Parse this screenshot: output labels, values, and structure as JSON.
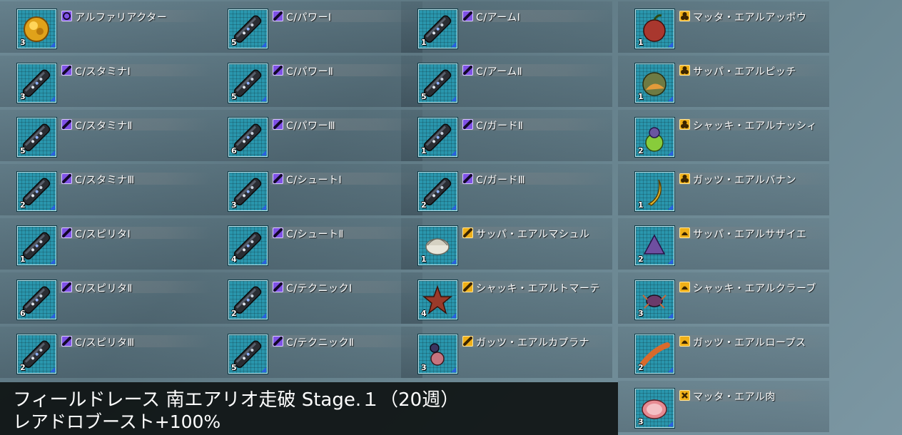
{
  "columns": [
    {
      "items": [
        {
          "name": "アルファリアクター",
          "count": "3",
          "icon": "alpha-reactor-icon",
          "category": "purple-circle"
        },
        {
          "name": "C/スタミナⅠ",
          "count": "3",
          "icon": "capsule-icon",
          "category": "purple-capsule"
        },
        {
          "name": "C/スタミナⅡ",
          "count": "5",
          "icon": "capsule-icon",
          "category": "purple-capsule"
        },
        {
          "name": "C/スタミナⅢ",
          "count": "2",
          "icon": "capsule-icon",
          "category": "purple-capsule"
        },
        {
          "name": "C/スピリタⅠ",
          "count": "1",
          "icon": "capsule-icon",
          "category": "purple-capsule"
        },
        {
          "name": "C/スピリタⅡ",
          "count": "6",
          "icon": "capsule-icon",
          "category": "purple-capsule"
        },
        {
          "name": "C/スピリタⅢ",
          "count": "2",
          "icon": "capsule-icon",
          "category": "purple-capsule"
        }
      ]
    },
    {
      "items": [
        {
          "name": "C/パワーⅠ",
          "count": "5",
          "icon": "capsule-icon",
          "category": "purple-capsule"
        },
        {
          "name": "C/パワーⅡ",
          "count": "5",
          "icon": "capsule-icon",
          "category": "purple-capsule"
        },
        {
          "name": "C/パワーⅢ",
          "count": "6",
          "icon": "capsule-icon",
          "category": "purple-capsule"
        },
        {
          "name": "C/シュートⅠ",
          "count": "3",
          "icon": "capsule-icon",
          "category": "purple-capsule"
        },
        {
          "name": "C/シュートⅡ",
          "count": "4",
          "icon": "capsule-icon",
          "category": "purple-capsule"
        },
        {
          "name": "C/テクニックⅠ",
          "count": "2",
          "icon": "capsule-icon",
          "category": "purple-capsule"
        },
        {
          "name": "C/テクニックⅡ",
          "count": "5",
          "icon": "capsule-icon",
          "category": "purple-capsule"
        }
      ]
    },
    {
      "items": [
        {
          "name": "C/アームⅠ",
          "count": "1",
          "icon": "capsule-icon",
          "category": "purple-capsule"
        },
        {
          "name": "C/アームⅡ",
          "count": "5",
          "icon": "capsule-icon",
          "category": "purple-capsule"
        },
        {
          "name": "C/ガードⅡ",
          "count": "1",
          "icon": "capsule-icon",
          "category": "purple-capsule"
        },
        {
          "name": "C/ガードⅢ",
          "count": "2",
          "icon": "capsule-icon",
          "category": "purple-capsule"
        },
        {
          "name": "サッパ・エアルマシュル",
          "count": "1",
          "icon": "shell-icon",
          "category": "gold-fish"
        },
        {
          "name": "シャッキ・エアルトマーテ",
          "count": "4",
          "icon": "starfish-icon",
          "category": "gold-fish"
        },
        {
          "name": "ガッツ・エアルカプラナ",
          "count": "3",
          "icon": "crab-fish-icon",
          "category": "gold-fish"
        }
      ]
    },
    {
      "items": [
        {
          "name": "マッタ・エアルアッポウ",
          "count": "1",
          "icon": "apple-icon",
          "category": "gold-fruit"
        },
        {
          "name": "サッパ・エアルピッチ",
          "count": "1",
          "icon": "peach-icon",
          "category": "gold-fruit"
        },
        {
          "name": "シャッキ・エアルナッシィ",
          "count": "2",
          "icon": "pear-icon",
          "category": "gold-fruit"
        },
        {
          "name": "ガッツ・エアルバナン",
          "count": "1",
          "icon": "banana-icon",
          "category": "gold-fruit"
        },
        {
          "name": "サッパ・エアルサザイエ",
          "count": "2",
          "icon": "turban-shell-icon",
          "category": "gold-seafood"
        },
        {
          "name": "シャッキ・エアルクラーブ",
          "count": "3",
          "icon": "crab-icon",
          "category": "gold-seafood"
        },
        {
          "name": "ガッツ・エアルロープス",
          "count": "2",
          "icon": "lobster-icon",
          "category": "gold-seafood"
        },
        {
          "name": "マッタ・エアル肉",
          "count": "3",
          "icon": "meat-icon",
          "category": "gold-meat"
        }
      ]
    }
  ],
  "caption": {
    "line1": "フィールドレース 南エアリオ走破 Stage.１（20週）",
    "line2": "レアドロブースト+100%"
  },
  "colors": {
    "frame": "#2a96ad",
    "purple_tag": "#7f52e6",
    "gold_tag": "#f0b018",
    "rarity_corner": "#2b5fe0"
  }
}
